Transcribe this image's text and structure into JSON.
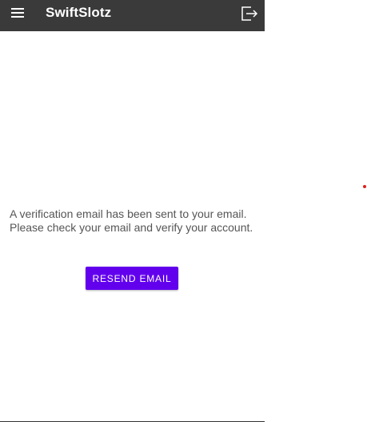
{
  "appbar": {
    "title": "SwiftSlotz",
    "menu_icon": "hamburger-menu-icon",
    "logout_icon": "logout-icon",
    "background_color": "#3a3a3a"
  },
  "main": {
    "message": "A verification email has been sent to your email. Please check your email and verify your account.",
    "resend_button_label": "RESEND EMAIL",
    "accent_color": "#6200ee"
  },
  "indicator": {
    "color": "#e02020"
  }
}
